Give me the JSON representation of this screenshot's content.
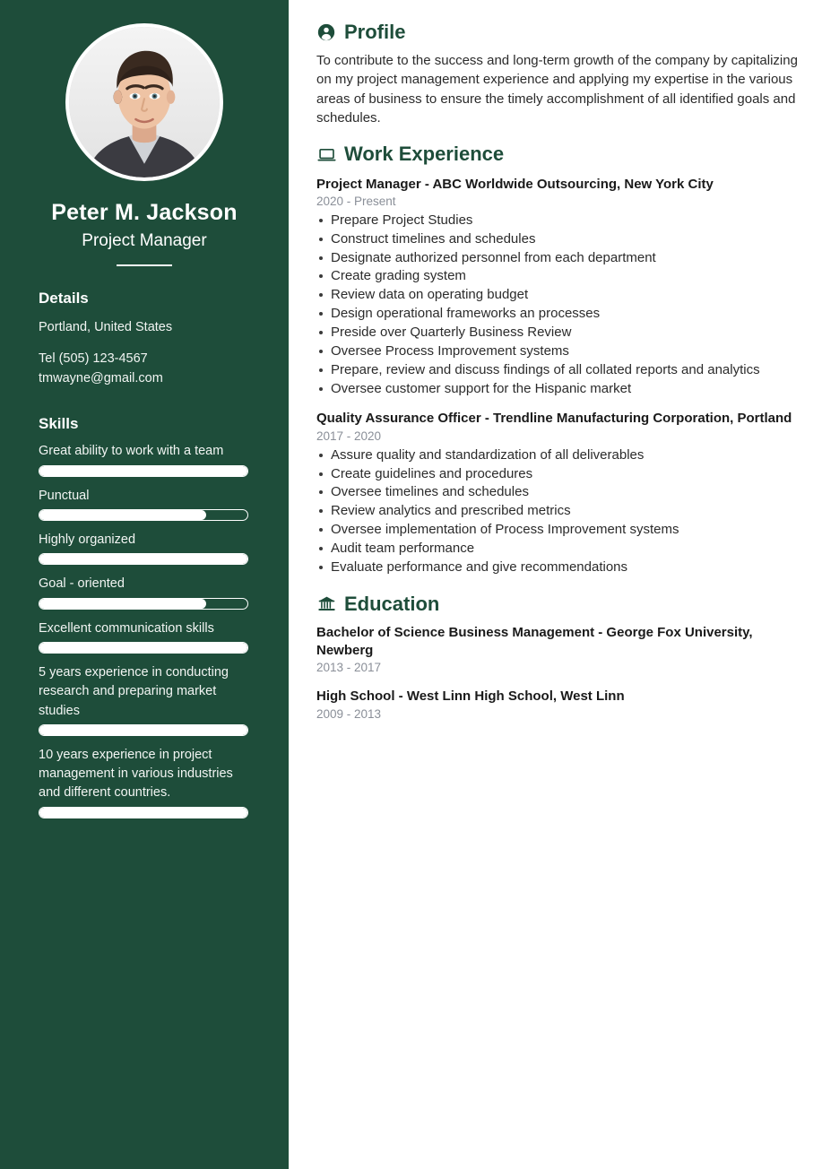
{
  "sidebar": {
    "photo_alt": "profile-photo",
    "name": "Peter M. Jackson",
    "job_title": "Project Manager",
    "details_heading": "Details",
    "location": "Portland, United States",
    "phone": "Tel (505) 123-4567",
    "email": "tmwayne@gmail.com",
    "skills_heading": "Skills",
    "skills": [
      {
        "label": "Great ability to work with a team",
        "level": 100
      },
      {
        "label": "Punctual",
        "level": 80
      },
      {
        "label": "Highly organized",
        "level": 100
      },
      {
        "label": "Goal - oriented",
        "level": 80
      },
      {
        "label": "Excellent communication skills",
        "level": 100
      },
      {
        "label": "5 years experience in conducting research and preparing market studies",
        "level": 100
      },
      {
        "label": "10 years experience in project management in various industries and different countries.",
        "level": 100
      }
    ]
  },
  "main": {
    "profile": {
      "icon": "person-circle-icon",
      "heading": "Profile",
      "text": "To contribute to the success and long-term growth of the company by capitalizing on my project management experience and applying my expertise in the various areas of business to ensure the timely accomplishment of all identified goals and schedules."
    },
    "work": {
      "icon": "laptop-icon",
      "heading": "Work Experience",
      "entries": [
        {
          "title": "Project Manager - ABC Worldwide Outsourcing, New York City",
          "date": "2020 - Present",
          "bullets": [
            "Prepare Project Studies",
            "Construct timelines and schedules",
            "Designate authorized personnel from each department",
            "Create grading system",
            "Review data on operating budget",
            "Design operational frameworks an processes",
            "Preside over Quarterly Business Review",
            "Oversee Process Improvement systems",
            "Prepare, review and discuss findings of all collated reports and analytics",
            "Oversee customer support for the Hispanic market"
          ]
        },
        {
          "title": "Quality Assurance Officer - Trendline Manufacturing Corporation, Portland",
          "date": "2017 - 2020",
          "bullets": [
            "Assure quality and standardization of all deliverables",
            "Create guidelines and procedures",
            "Oversee timelines and schedules",
            "Review analytics and prescribed metrics",
            "Oversee implementation of Process Improvement systems",
            "Audit team performance",
            "Evaluate performance and give recommendations"
          ]
        }
      ]
    },
    "education": {
      "icon": "bank-building-icon",
      "heading": "Education",
      "entries": [
        {
          "title": "Bachelor of Science Business Management - George Fox University, Newberg",
          "date": "2013 - 2017"
        },
        {
          "title": "High School - West Linn High School, West Linn",
          "date": "2009 - 2013"
        }
      ]
    }
  },
  "colors": {
    "sidebar_bg": "#1e4d3a",
    "heading_green": "#1e4d3a",
    "body_text": "#2b2b2b",
    "date_gray": "#8a8f98",
    "page_bg": "#ffffff"
  }
}
